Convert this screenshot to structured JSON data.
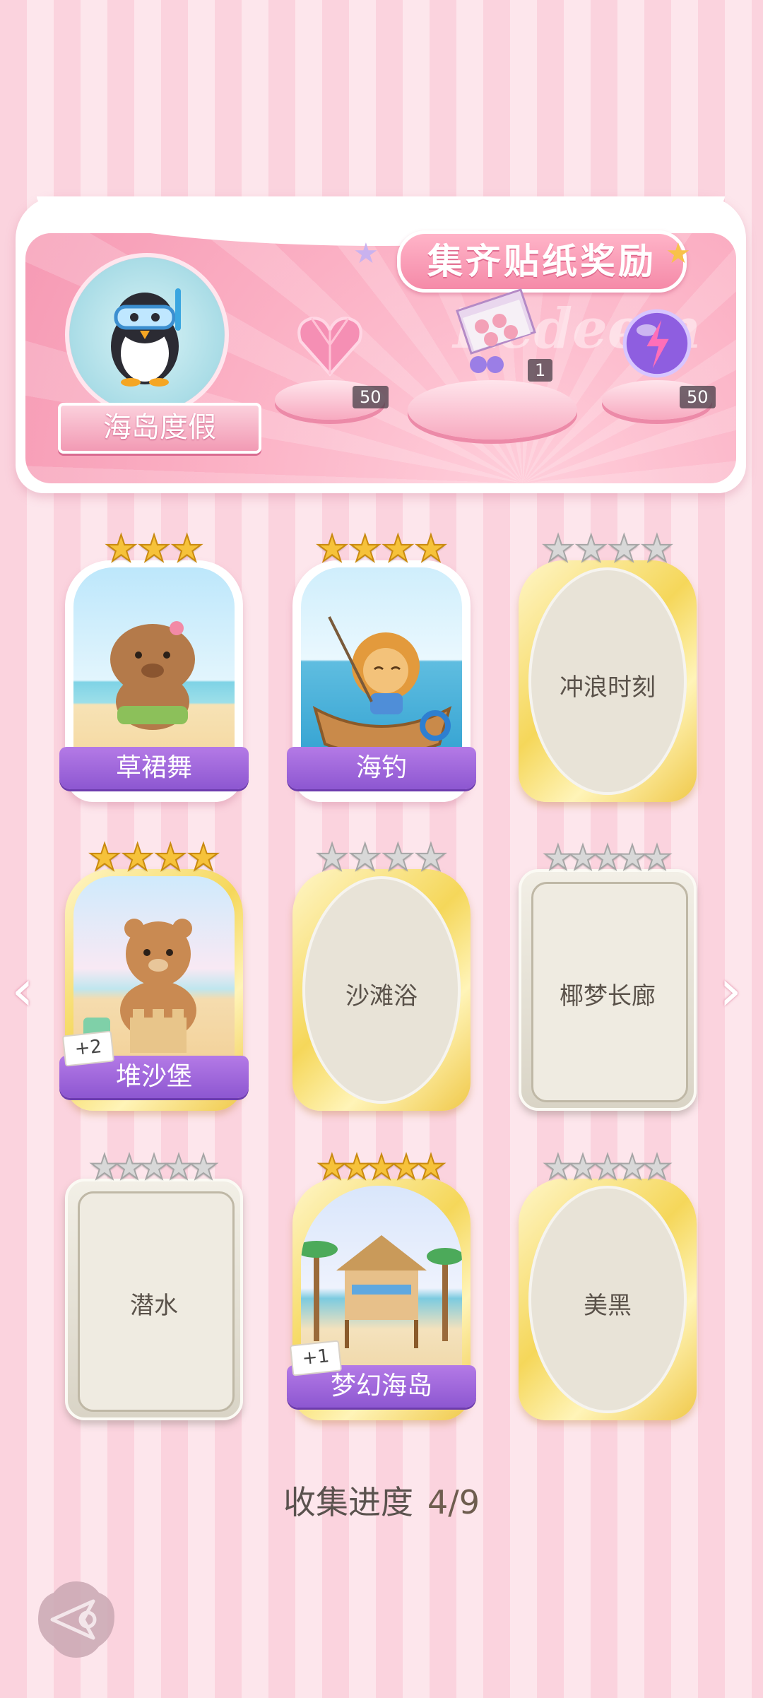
{
  "banner": {
    "title": "集齐贴纸奖励",
    "watermark": "Redeem",
    "theme_label": "海岛度假",
    "theme_icon": "penguin-snorkel-icon",
    "rewards": [
      {
        "icon": "pink-heart-gem-icon",
        "count": "50"
      },
      {
        "icon": "gift-box-icon",
        "count": "1"
      },
      {
        "icon": "purple-energy-orb-icon",
        "count": "50"
      }
    ]
  },
  "stickers": [
    {
      "name": "草裙舞",
      "collected": true,
      "stars": 3,
      "max_stars": 3,
      "bonus": "",
      "art": "capybara-hula-icon"
    },
    {
      "name": "海钓",
      "collected": true,
      "stars": 4,
      "max_stars": 4,
      "bonus": "",
      "art": "lion-fishing-icon"
    },
    {
      "name": "冲浪时刻",
      "collected": false,
      "stars": 0,
      "max_stars": 4,
      "bonus": ""
    },
    {
      "name": "堆沙堡",
      "collected": true,
      "stars": 4,
      "max_stars": 4,
      "bonus": "+2",
      "art": "bear-sandcastle-icon"
    },
    {
      "name": "沙滩浴",
      "collected": false,
      "stars": 0,
      "max_stars": 4,
      "bonus": ""
    },
    {
      "name": "椰梦长廊",
      "collected": false,
      "stars": 0,
      "max_stars": 5,
      "bonus": ""
    },
    {
      "name": "潜水",
      "collected": false,
      "stars": 0,
      "max_stars": 5,
      "bonus": ""
    },
    {
      "name": "梦幻海岛",
      "collected": true,
      "stars": 5,
      "max_stars": 5,
      "bonus": "+1",
      "art": "beach-hut-icon"
    },
    {
      "name": "美黑",
      "collected": false,
      "stars": 0,
      "max_stars": 5,
      "bonus": ""
    }
  ],
  "progress": {
    "label": "收集进度",
    "value": "4/9"
  },
  "nav": {
    "prev_icon": "chevron-left-icon",
    "next_icon": "chevron-right-icon",
    "back_icon": "back-arrow-icon"
  },
  "colors": {
    "label_purple": "#9a63da",
    "star_gold": "#f6c23a",
    "star_grey": "#d8d8d8",
    "banner_pink": "#f69ab4"
  }
}
